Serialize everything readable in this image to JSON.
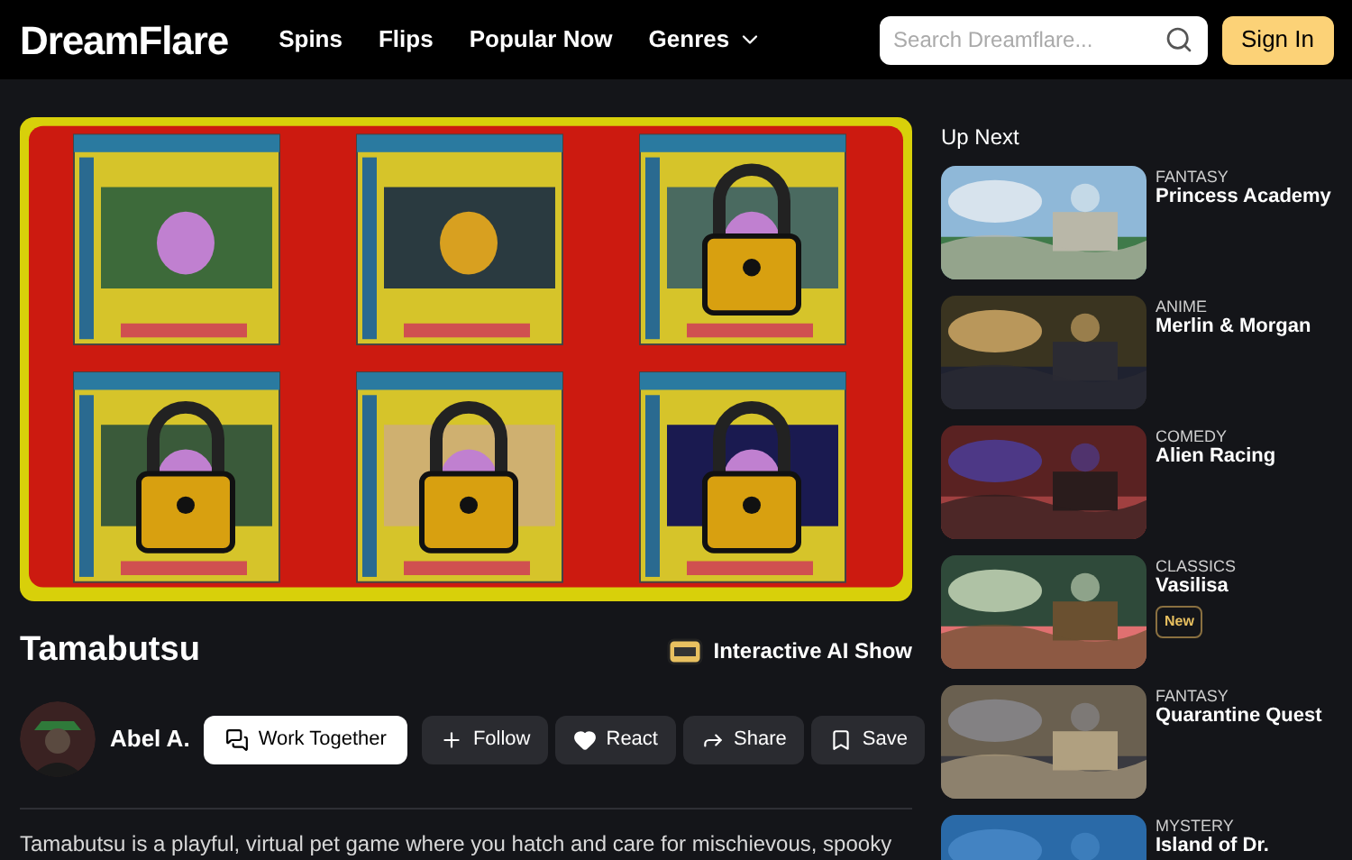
{
  "header": {
    "logo": "DreamFlare",
    "nav": [
      {
        "label": "Spins",
        "dropdown": false
      },
      {
        "label": "Flips",
        "dropdown": false
      },
      {
        "label": "Popular Now",
        "dropdown": false
      },
      {
        "label": "Genres",
        "dropdown": true
      }
    ],
    "search": {
      "placeholder": "Search Dreamflare..."
    },
    "sign_in": "Sign In"
  },
  "show": {
    "title": "Tamabutsu",
    "badge": "Interactive AI Show",
    "author": "Abel A.",
    "actions": [
      {
        "label": "Work Together",
        "kind": "primary"
      },
      {
        "label": "Follow",
        "kind": "secondary"
      },
      {
        "label": "React",
        "kind": "secondary"
      },
      {
        "label": "Share",
        "kind": "secondary"
      },
      {
        "label": "Save",
        "kind": "secondary"
      }
    ],
    "description": "Tamabutsu is a playful, virtual pet game where you hatch and care for mischievous, spooky"
  },
  "up_next": {
    "title": "Up Next",
    "items": [
      {
        "genre": "FANTASY",
        "title": "Princess Academy"
      },
      {
        "genre": "ANIME",
        "title": "Merlin & Morgan"
      },
      {
        "genre": "COMEDY",
        "title": "Alien Racing"
      },
      {
        "genre": "CLASSICS",
        "title": "Vasilisa",
        "badge": "New"
      },
      {
        "genre": "FANTASY",
        "title": "Quarantine Quest"
      },
      {
        "genre": "MYSTERY",
        "title": "Island of Dr."
      }
    ]
  }
}
